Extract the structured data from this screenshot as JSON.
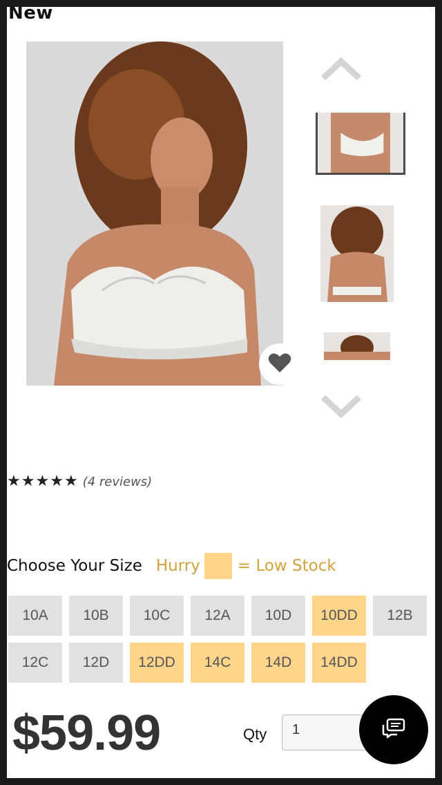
{
  "header": {
    "new_label": "New"
  },
  "product": {
    "reviews": {
      "stars": 5,
      "count_text": "(4 reviews)"
    },
    "price": "$59.99"
  },
  "size": {
    "title": "Choose Your Size",
    "hurry": "Hurry",
    "low_stock": "= Low Stock",
    "options": [
      {
        "label": "10A",
        "low": false
      },
      {
        "label": "10B",
        "low": false
      },
      {
        "label": "10C",
        "low": false
      },
      {
        "label": "12A",
        "low": false
      },
      {
        "label": "10D",
        "low": false
      },
      {
        "label": "10DD",
        "low": true
      },
      {
        "label": "12B",
        "low": false
      },
      {
        "label": "12C",
        "low": false
      },
      {
        "label": "12D",
        "low": false
      },
      {
        "label": "12DD",
        "low": true
      },
      {
        "label": "14C",
        "low": true
      },
      {
        "label": "14D",
        "low": true
      },
      {
        "label": "14DD",
        "low": true
      }
    ]
  },
  "qty": {
    "label": "Qty",
    "value": "1"
  },
  "icons": {
    "favorite": "heart-icon",
    "up": "chevron-up-icon",
    "down": "chevron-down-icon",
    "chat": "chat-icon"
  },
  "colors": {
    "low_stock": "#ffd58c",
    "accent_text": "#d2a23c",
    "size_default": "#e1e1e1"
  }
}
